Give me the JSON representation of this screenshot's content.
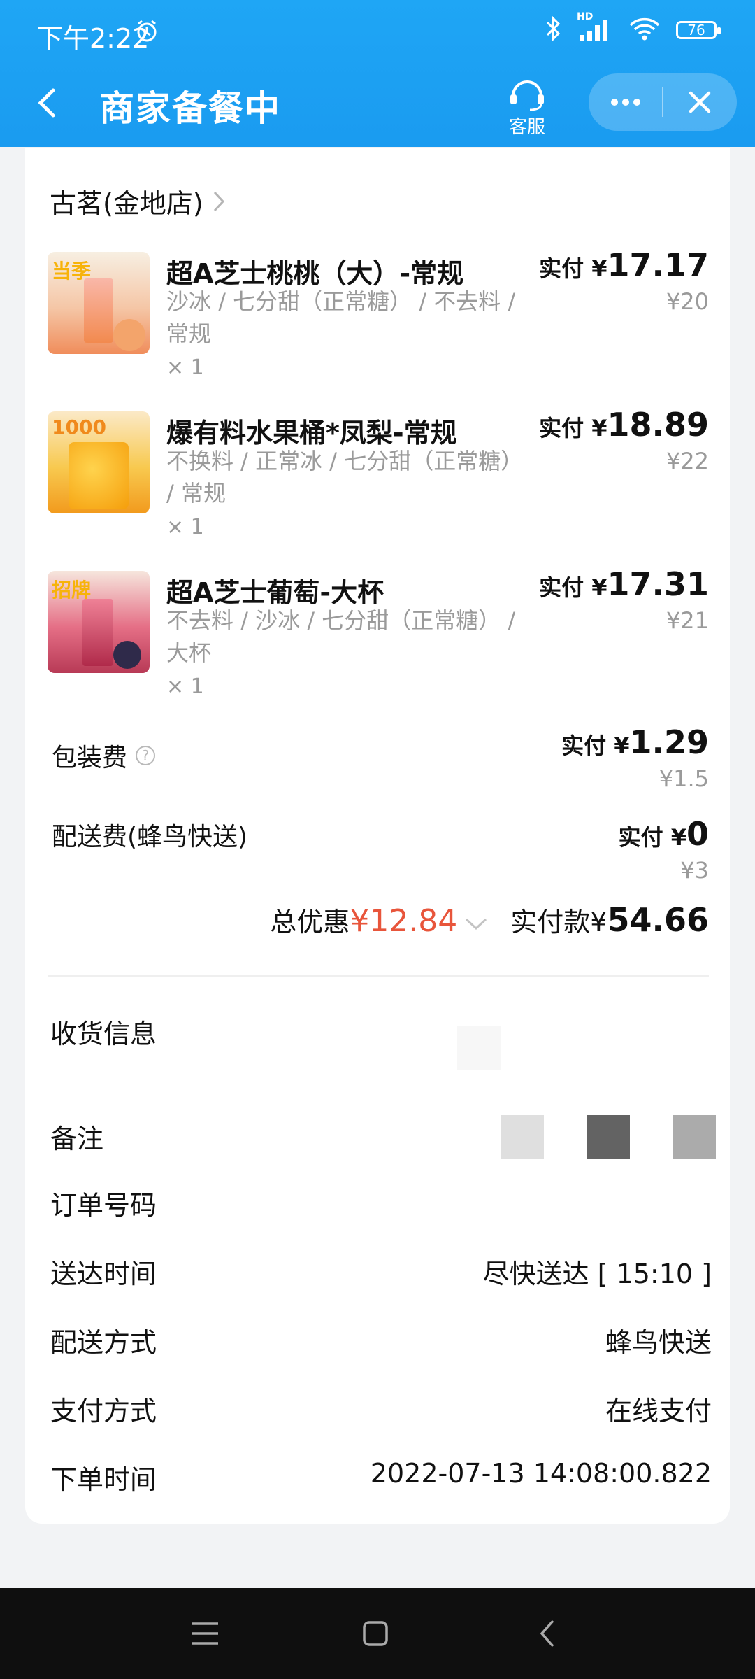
{
  "status_bar": {
    "time": "下午2:22",
    "network": "HD",
    "battery": "76"
  },
  "header": {
    "title": "商家备餐中",
    "service_label": "客服"
  },
  "store": {
    "name": "古茗(金地店)"
  },
  "items": [
    {
      "name": "超A芝士桃桃（大）-常规",
      "spec": "沙冰 / 七分甜（正常糖） / 不去料 / 常规",
      "qty": "× 1",
      "pay_label": "实付 ¥",
      "pay_amount": "17.17",
      "original": "¥20",
      "tag": "当季"
    },
    {
      "name": "爆有料水果桶*凤梨-常规",
      "spec": "不换料 / 正常冰 / 七分甜（正常糖） / 常规",
      "qty": "× 1",
      "pay_label": "实付 ¥",
      "pay_amount": "18.89",
      "original": "¥22",
      "tag": "1000"
    },
    {
      "name": "超A芝士葡萄-大杯",
      "spec": "不去料 / 沙冰 / 七分甜（正常糖） / 大杯",
      "qty": "× 1",
      "pay_label": "实付 ¥",
      "pay_amount": "17.31",
      "original": "¥21",
      "tag": "招牌"
    }
  ],
  "fees": [
    {
      "name": "包装费",
      "pay_label": "实付 ¥",
      "pay_amount": "1.29",
      "original": "¥1.5"
    },
    {
      "name": "配送费(蜂鸟快送)",
      "pay_label": "实付 ¥",
      "pay_amount": "0",
      "original": "¥3"
    }
  ],
  "summary": {
    "discount_label": "总优惠",
    "discount_value": "¥12.84",
    "paid_label": "实付款¥",
    "paid_value": "54.66"
  },
  "info": {
    "receiver_label": "收货信息",
    "remark_label": "备注",
    "order_no_label": "订单号码",
    "delivery_time_label": "送达时间",
    "delivery_time_value": "尽快送达 [ 15:10 ]",
    "delivery_method_label": "配送方式",
    "delivery_method_value": "蜂鸟快送",
    "payment_method_label": "支付方式",
    "payment_method_value": "在线支付",
    "order_time_label": "下单时间",
    "order_time_value": "2022-07-13 14:08:00.822"
  },
  "colors": {
    "header": "#1a9bf0",
    "discount": "#e8553b",
    "muted": "#9a9a9a"
  }
}
